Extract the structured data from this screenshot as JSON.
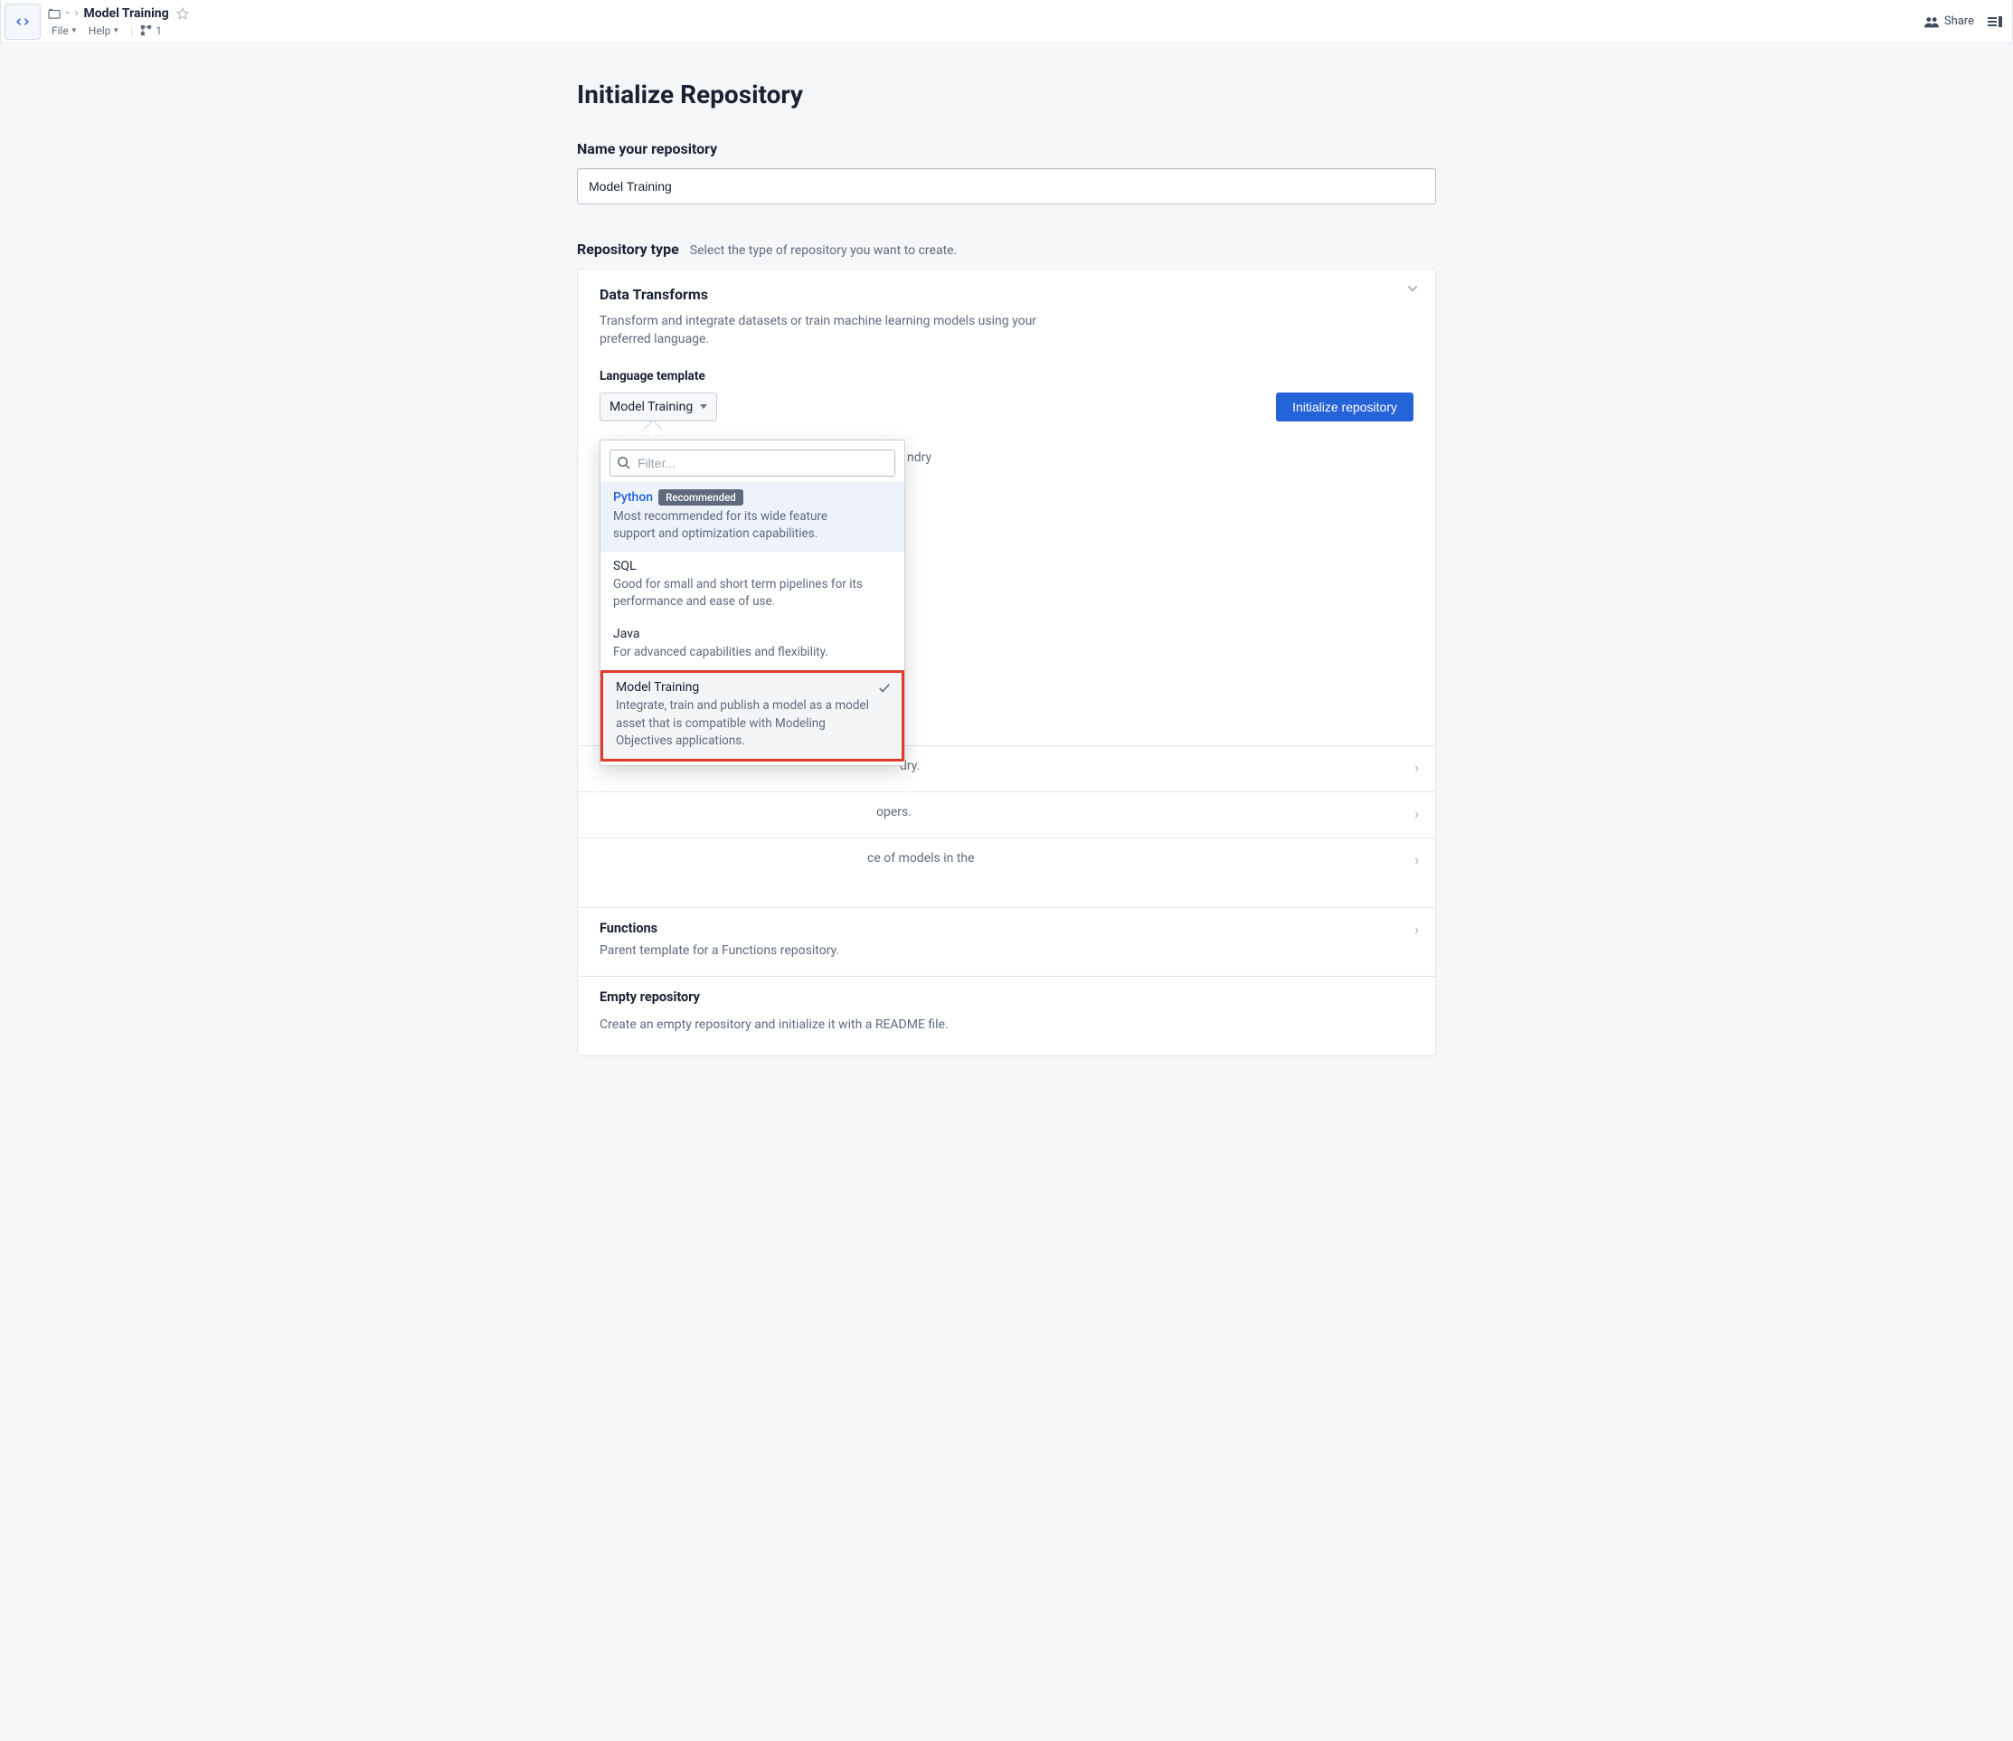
{
  "header": {
    "breadcrumb_dash": "-",
    "breadcrumb_title": "Model Training",
    "menu_file": "File",
    "menu_help": "Help",
    "branch_count": "1",
    "share_label": "Share"
  },
  "page": {
    "title": "Initialize Repository",
    "name_label": "Name your repository",
    "name_value": "Model Training",
    "type_label": "Repository type",
    "type_hint": "Select the type of repository you want to create."
  },
  "data_transforms": {
    "title": "Data Transforms",
    "desc": "Transform and integrate datasets or train machine learning models using your preferred language.",
    "lang_label": "Language template",
    "selected": "Model Training",
    "button": "Initialize repository"
  },
  "dropdown": {
    "filter_placeholder": "Filter...",
    "options": [
      {
        "title": "Python",
        "badge": "Recommended",
        "desc": "Most recommended for its wide feature support and optimization capabilities."
      },
      {
        "title": "SQL",
        "desc": "Good for small and short term pipelines for its performance and ease of use."
      },
      {
        "title": "Java",
        "desc": "For advanced capabilities and flexibility."
      },
      {
        "title": "Model Training",
        "desc": "Integrate, train and publish a model as a model asset that is compatible with Modeling Objectives applications."
      }
    ]
  },
  "hidden_cards": [
    {
      "title_fragment": "ndry"
    },
    {
      "title_fragment": "dry."
    },
    {
      "title_fragment": "opers."
    },
    {
      "title_fragment": "ce of models in the"
    }
  ],
  "functions_card": {
    "title": "Functions",
    "desc": "Parent template for a Functions repository."
  },
  "empty_card": {
    "title": "Empty repository",
    "desc": "Create an empty repository and initialize it with a README file."
  }
}
